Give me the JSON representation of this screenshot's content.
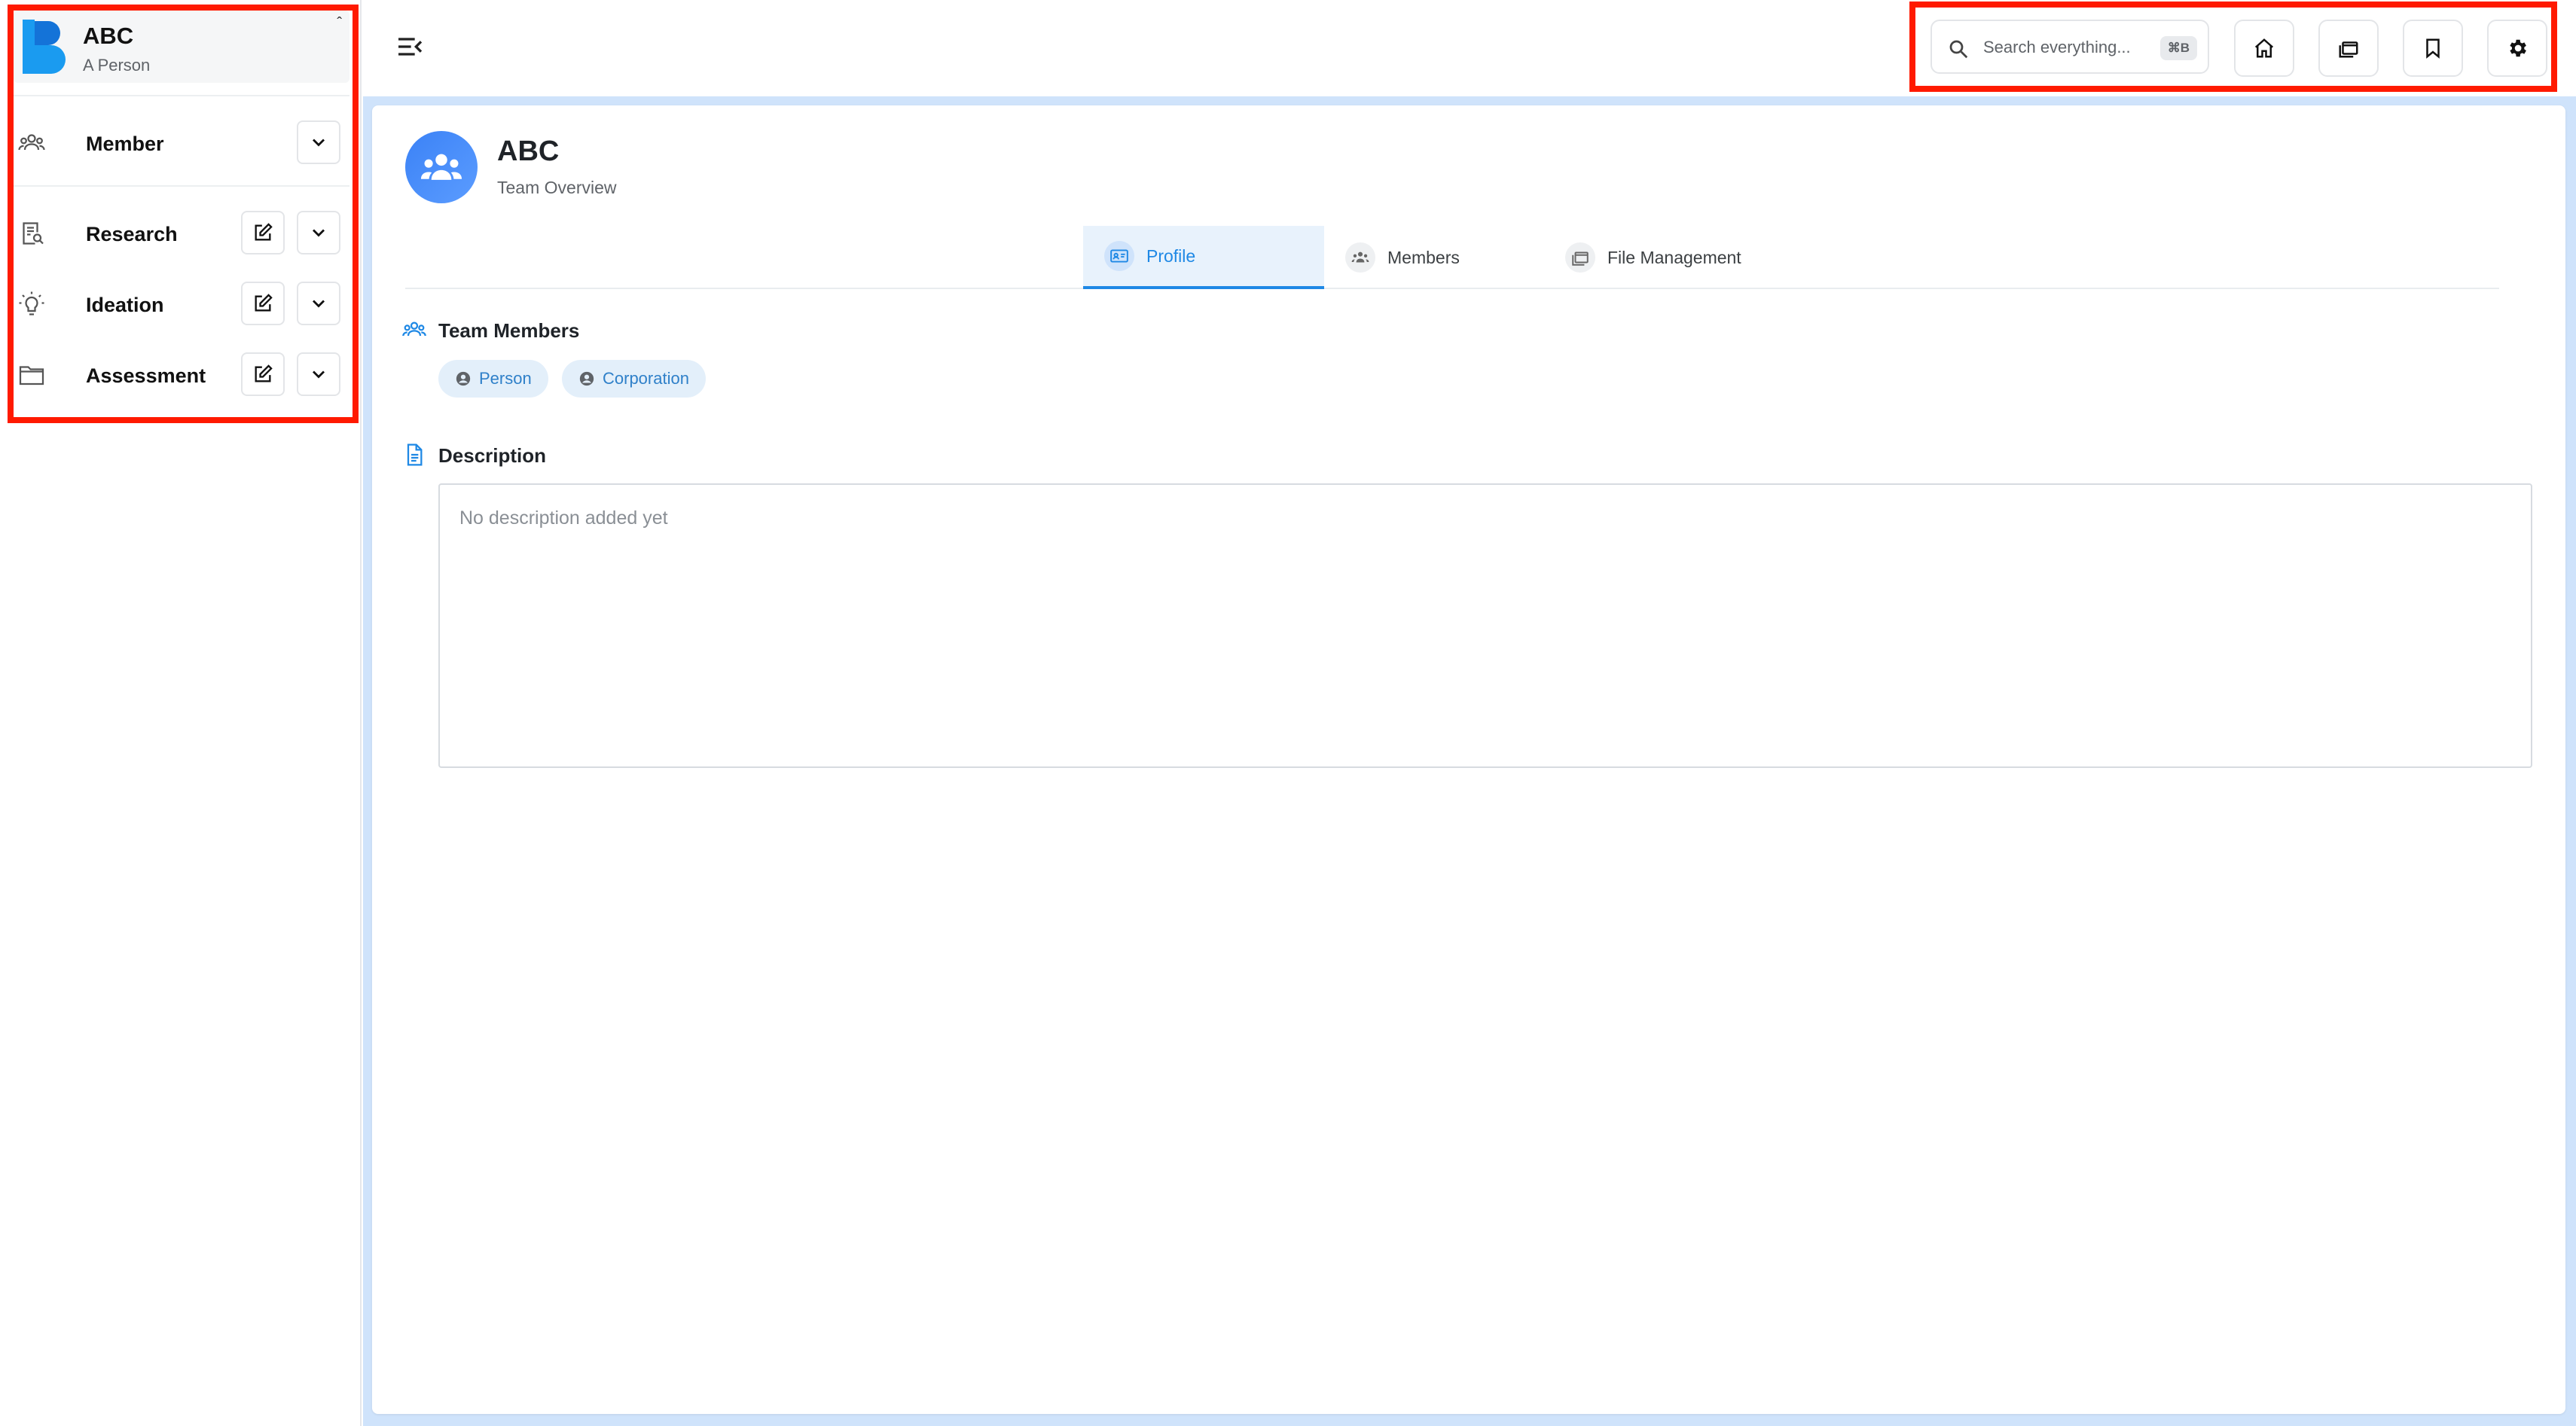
{
  "sidebar": {
    "brand": {
      "title": "ABC",
      "subtitle": "A Person",
      "collapse_glyph": "ˆ"
    },
    "items": [
      {
        "label": "Member",
        "icon": "people-icon",
        "has_edit": false
      },
      {
        "label": "Research",
        "icon": "document-search-icon",
        "has_edit": true
      },
      {
        "label": "Ideation",
        "icon": "lightbulb-icon",
        "has_edit": true
      },
      {
        "label": "Assessment",
        "icon": "folder-icon",
        "has_edit": true
      }
    ]
  },
  "topbar": {
    "search": {
      "placeholder": "Search everything...",
      "shortcut": "⌘B"
    },
    "buttons": [
      "home-icon",
      "folders-icon",
      "bookmark-icon",
      "gear-icon"
    ]
  },
  "team": {
    "name": "ABC",
    "subtitle": "Team Overview"
  },
  "tabs": [
    {
      "label": "Profile",
      "active": true
    },
    {
      "label": "Members",
      "active": false
    },
    {
      "label": "File Management",
      "active": false
    }
  ],
  "sections": {
    "team_members": {
      "title": "Team Members",
      "chips": [
        "Person",
        "Corporation"
      ]
    },
    "description": {
      "title": "Description",
      "placeholder": "No description added yet"
    }
  },
  "colors": {
    "accent": "#1e88e5",
    "highlight": "#ff1a00",
    "main_background": "#cfe3fb"
  }
}
